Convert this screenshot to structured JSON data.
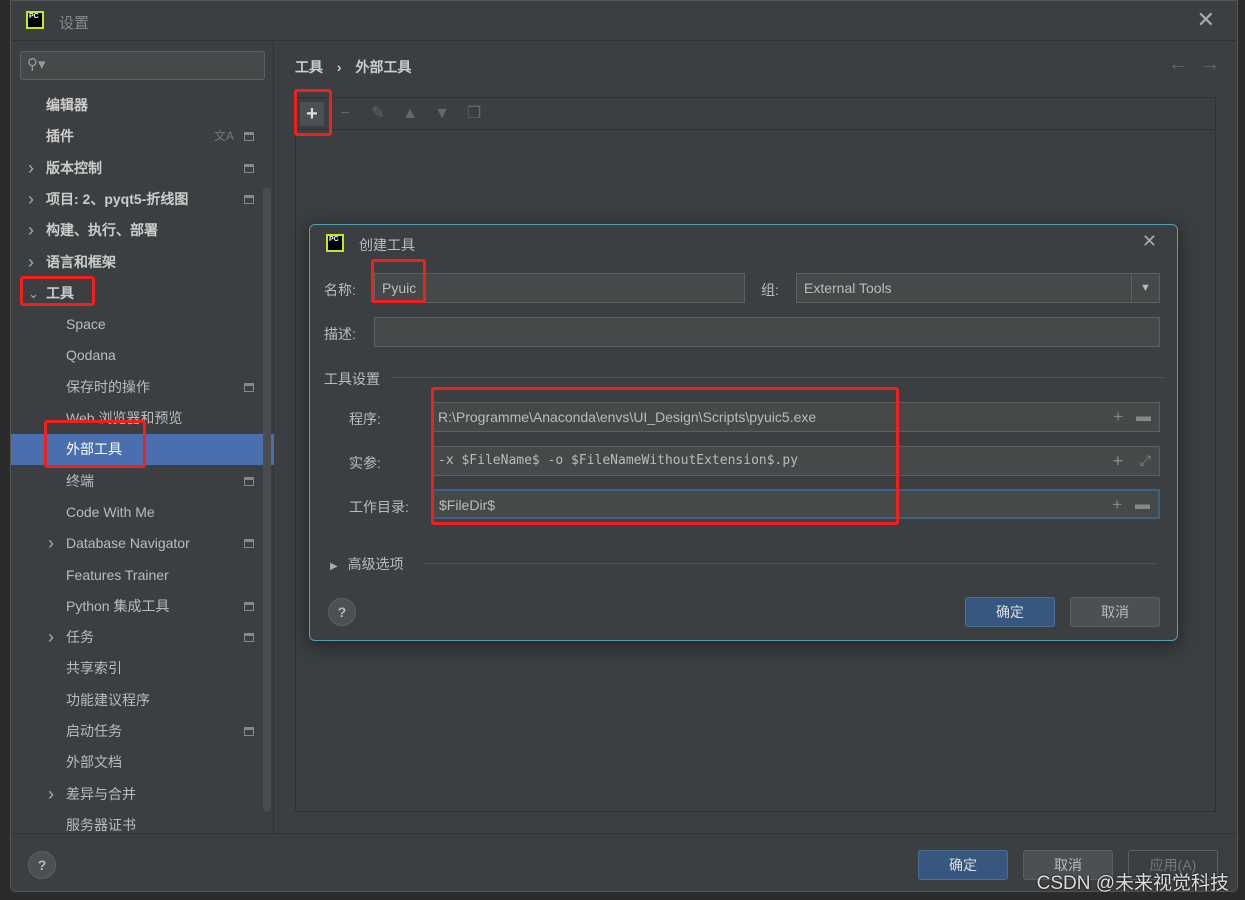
{
  "window": {
    "title": "设置"
  },
  "sidebar": {
    "items": [
      {
        "label": "编辑器",
        "level": 0,
        "bold": true
      },
      {
        "label": "插件",
        "level": 0,
        "bold": true,
        "extra_icon": "translate-icon",
        "cfg": true
      },
      {
        "label": "版本控制",
        "level": 0,
        "bold": true,
        "chevron": ">",
        "cfg": true
      },
      {
        "label": "项目: 2、pyqt5-折线图",
        "level": 0,
        "bold": true,
        "chevron": ">",
        "cfg": true
      },
      {
        "label": "构建、执行、部署",
        "level": 0,
        "bold": true,
        "chevron": ">"
      },
      {
        "label": "语言和框架",
        "level": 0,
        "bold": true,
        "chevron": ">"
      },
      {
        "label": "工具",
        "level": 0,
        "bold": true,
        "chevron": "v"
      },
      {
        "label": "Space",
        "level": 1
      },
      {
        "label": "Qodana",
        "level": 1
      },
      {
        "label": "保存时的操作",
        "level": 1,
        "cfg": true
      },
      {
        "label": "Web 浏览器和预览",
        "level": 1
      },
      {
        "label": "外部工具",
        "level": 1,
        "selected": true
      },
      {
        "label": "终端",
        "level": 1,
        "cfg": true
      },
      {
        "label": "Code With Me",
        "level": 1
      },
      {
        "label": "Database Navigator",
        "level": 1,
        "chevron": ">",
        "cfg": true
      },
      {
        "label": "Features Trainer",
        "level": 1
      },
      {
        "label": "Python 集成工具",
        "level": 1,
        "cfg": true
      },
      {
        "label": "任务",
        "level": 1,
        "chevron": ">",
        "cfg": true
      },
      {
        "label": "共享索引",
        "level": 1
      },
      {
        "label": "功能建议程序",
        "level": 1
      },
      {
        "label": "启动任务",
        "level": 1,
        "cfg": true
      },
      {
        "label": "外部文档",
        "level": 1
      },
      {
        "label": "差异与合并",
        "level": 1,
        "chevron": ">"
      },
      {
        "label": "服务器证书",
        "level": 1
      }
    ]
  },
  "breadcrumb": {
    "parent": "工具",
    "sep": "›",
    "current": "外部工具"
  },
  "footer": {
    "ok": "确定",
    "cancel": "取消",
    "apply": "应用(A)",
    "help": "?"
  },
  "dialog": {
    "title": "创建工具",
    "name_label": "名称:",
    "name_value": "Pyuic",
    "group_label": "组:",
    "group_value": "External Tools",
    "desc_label": "描述:",
    "desc_value": "",
    "section": "工具设置",
    "program_label": "程序:",
    "program_value": "R:\\Programme\\Anaconda\\envs\\UI_Design\\Scripts\\pyuic5.exe",
    "args_label": "实参:",
    "args_value": "-x $FileName$ -o $FileNameWithoutExtension$.py",
    "workdir_label": "工作目录:",
    "workdir_value": "$FileDir$",
    "advanced": "高级选项",
    "ok": "确定",
    "cancel": "取消",
    "help": "?"
  },
  "watermark": "CSDN @未来视觉科技",
  "colors": {
    "selection": "#4b6eaf",
    "primary_button": "#365880",
    "annotation": "#f21f1f"
  }
}
